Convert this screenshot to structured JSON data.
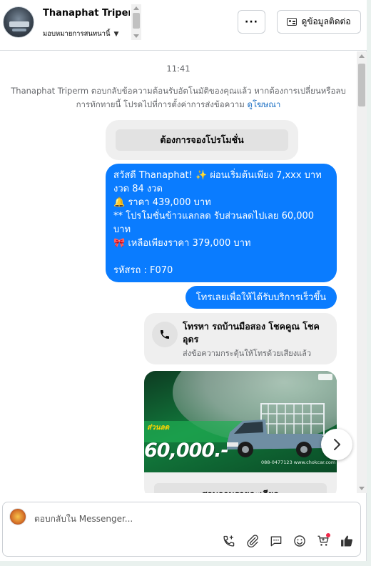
{
  "header": {
    "contact_name": "Thanaphat Triperm",
    "assign_label": "มอบหมายการสนทนานี้",
    "more_label": "···",
    "contact_info_label": "ดูข้อมูลติดต่อ"
  },
  "conversation": {
    "timestamp": "11:41",
    "auto_reply_note": "Thanaphat Triperm ตอบกลับข้อความต้อนรับอัตโนมัติของคุณแล้ว หากต้องการเปลี่ยนหรือลบการทักทายนี้ โปรดไปที่การตั้งค่าการส่งข้อความ",
    "auto_reply_link": "ดูโฆษณา",
    "quick_reply_button": "ต้องการจองโปรโมชั่น",
    "message_lines": [
      "สวัสดี Thanaphat! ✨  ผ่อนเริ่มต้นเพียง 7,xxx บาท งวด 84 งวด",
      "🔔 ราคา 439,000 บาท",
      "** โปรโมชั่นข้าวแลกลด รับส่วนลดไปเลย 60,000 บาท",
      "🎀  เหลือเพียงราคา 379,000 บาท",
      "",
      " รหัสรถ : F070"
    ],
    "call_prompt": "โทรเลยเพื่อให้ได้รับบริการเร็วขึ้น",
    "call_card_title": "โทรหา รถบ้านมือสอง โชคคูณ โชคอุดร",
    "call_card_subtitle": "ส่งข้อความกระตุ้นให้โทรด้วยเสียงแล้ว",
    "promo_card": {
      "tag": "ส่วนลด",
      "price": "60,000.-",
      "contact": "088-0477123 www.chokcar.com",
      "button_label": "สอบถามรายละเอียด"
    }
  },
  "composer": {
    "placeholder": "ตอบกลับใน Messenger...",
    "tools": [
      "phone-plus-icon",
      "paperclip-icon",
      "saved-reply-icon",
      "emoji-icon",
      "cart-icon",
      "thumbs-up-icon"
    ]
  },
  "colors": {
    "accent_blue": "#0a7cff",
    "link_blue": "#1b6fc4",
    "notification_red": "#f02849"
  }
}
